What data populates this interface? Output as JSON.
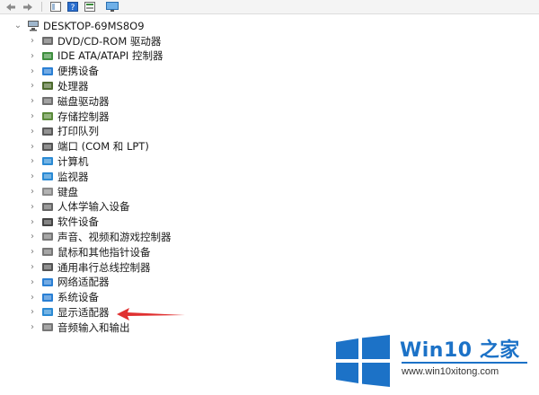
{
  "root": {
    "label": "DESKTOP-69MS8O9",
    "icon": "computer-tree-icon"
  },
  "devices": [
    {
      "label": "DVD/CD-ROM 驱动器",
      "icon": "dvd-drive-icon",
      "color": "#6b6b6b"
    },
    {
      "label": "IDE ATA/ATAPI 控制器",
      "icon": "ide-controller-icon",
      "color": "#3f8f3f"
    },
    {
      "label": "便携设备",
      "icon": "portable-device-icon",
      "color": "#2a7fd4"
    },
    {
      "label": "处理器",
      "icon": "processor-icon",
      "color": "#4d6b2e"
    },
    {
      "label": "磁盘驱动器",
      "icon": "disk-drive-icon",
      "color": "#707070"
    },
    {
      "label": "存储控制器",
      "icon": "storage-controller-icon",
      "color": "#5a8a3a"
    },
    {
      "label": "打印队列",
      "icon": "printer-icon",
      "color": "#5a5a5a"
    },
    {
      "label": "端口 (COM 和 LPT)",
      "icon": "port-icon",
      "color": "#555555"
    },
    {
      "label": "计算机",
      "icon": "computer-icon",
      "color": "#2a8ad4"
    },
    {
      "label": "监视器",
      "icon": "monitor-icon",
      "color": "#2a8ad4"
    },
    {
      "label": "键盘",
      "icon": "keyboard-icon",
      "color": "#8a8a8a"
    },
    {
      "label": "人体学输入设备",
      "icon": "hid-icon",
      "color": "#666666"
    },
    {
      "label": "软件设备",
      "icon": "software-device-icon",
      "color": "#444444"
    },
    {
      "label": "声音、视频和游戏控制器",
      "icon": "speaker-icon",
      "color": "#777777"
    },
    {
      "label": "鼠标和其他指针设备",
      "icon": "mouse-icon",
      "color": "#777777"
    },
    {
      "label": "通用串行总线控制器",
      "icon": "usb-icon",
      "color": "#555555"
    },
    {
      "label": "网络适配器",
      "icon": "network-adapter-icon",
      "color": "#2a7fd4"
    },
    {
      "label": "系统设备",
      "icon": "system-device-icon",
      "color": "#2a7fd4"
    },
    {
      "label": "显示适配器",
      "icon": "display-adapter-icon",
      "color": "#2a8ad4"
    },
    {
      "label": "音频输入和输出",
      "icon": "audio-io-icon",
      "color": "#777777"
    }
  ],
  "watermark": {
    "main": "Win10 之家",
    "url": "www.win10xitong.com"
  },
  "colors": {
    "annotation_arrow": "#e03030",
    "watermark_blue": "#1c72c7"
  }
}
